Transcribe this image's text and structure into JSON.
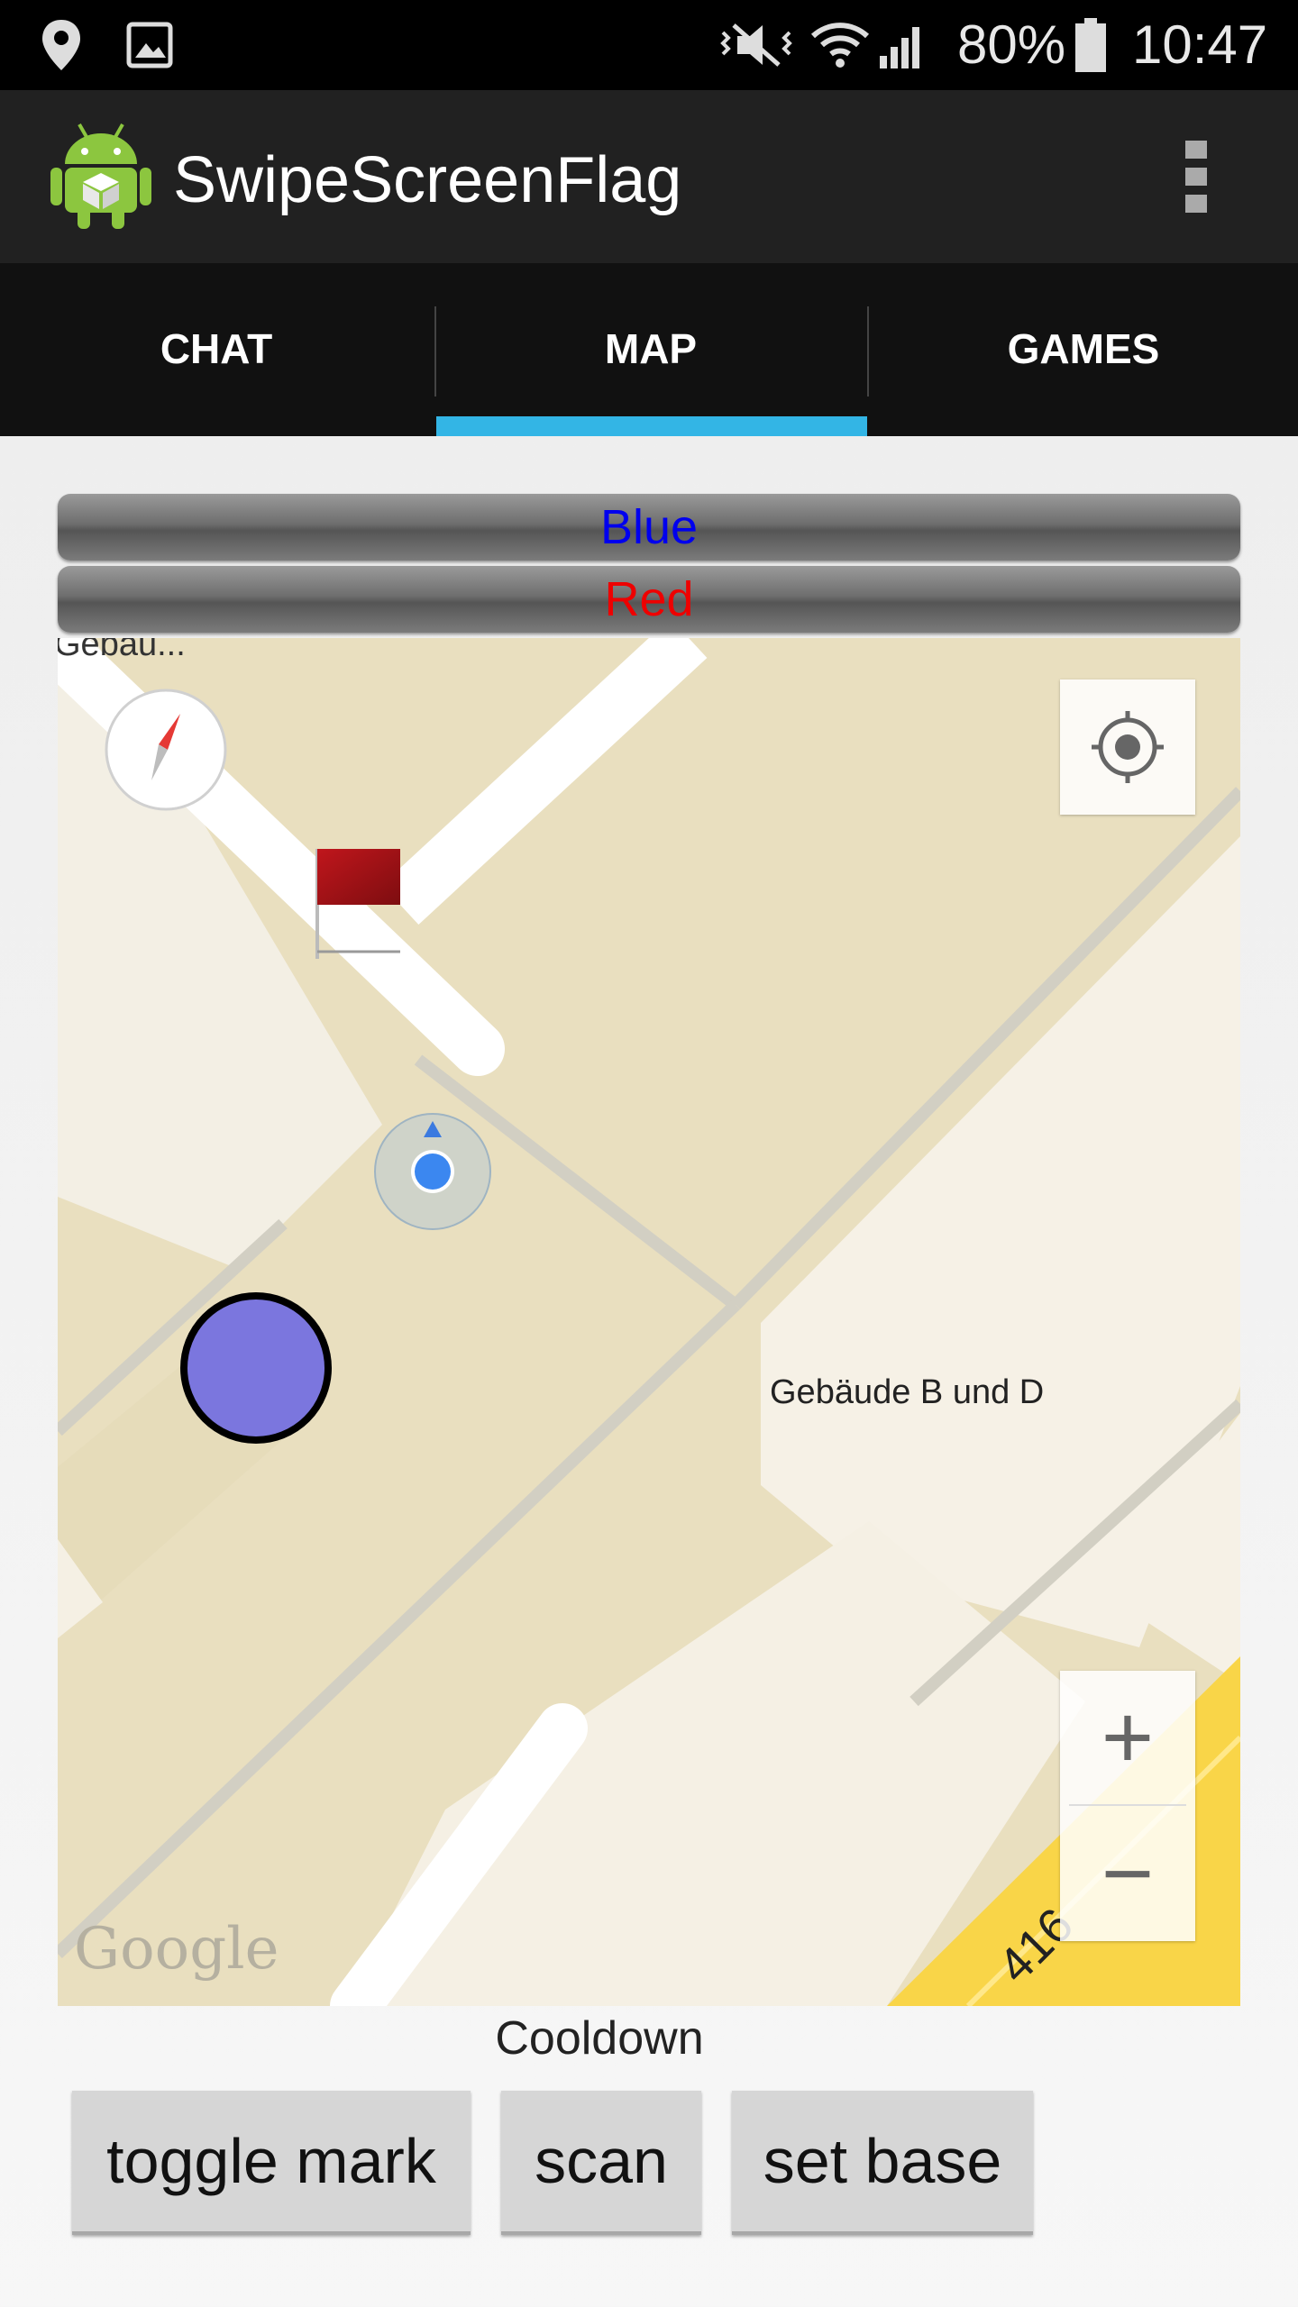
{
  "status_bar": {
    "battery": "80%",
    "time": "10:47"
  },
  "app": {
    "title": "SwipeScreenFlag"
  },
  "tabs": [
    {
      "label": "CHAT",
      "selected": false
    },
    {
      "label": "MAP",
      "selected": true
    },
    {
      "label": "GAMES",
      "selected": false
    }
  ],
  "teams": {
    "blue": "Blue",
    "red": "Red"
  },
  "map": {
    "place_label": "Gebäude B und D",
    "place_label_top": "Gebäu...",
    "road_label": "416",
    "attribution": "Google",
    "zoom_in": "+",
    "zoom_out": "−"
  },
  "cooldown_label": "Cooldown",
  "actions": {
    "toggle_mark": "toggle mark",
    "scan": "scan",
    "set_base": "set base"
  },
  "colors": {
    "tab_indicator": "#33b5e5",
    "blue_team": "#0000ee",
    "red_team": "#ee0000",
    "player_marker": "#7b76de"
  },
  "icons": [
    "location-icon",
    "gallery-icon",
    "vibrate-icon",
    "wifi-icon",
    "signal-icon",
    "battery-icon",
    "android-icon",
    "overflow-menu-icon",
    "compass-icon",
    "my-location-icon",
    "flag-icon"
  ]
}
